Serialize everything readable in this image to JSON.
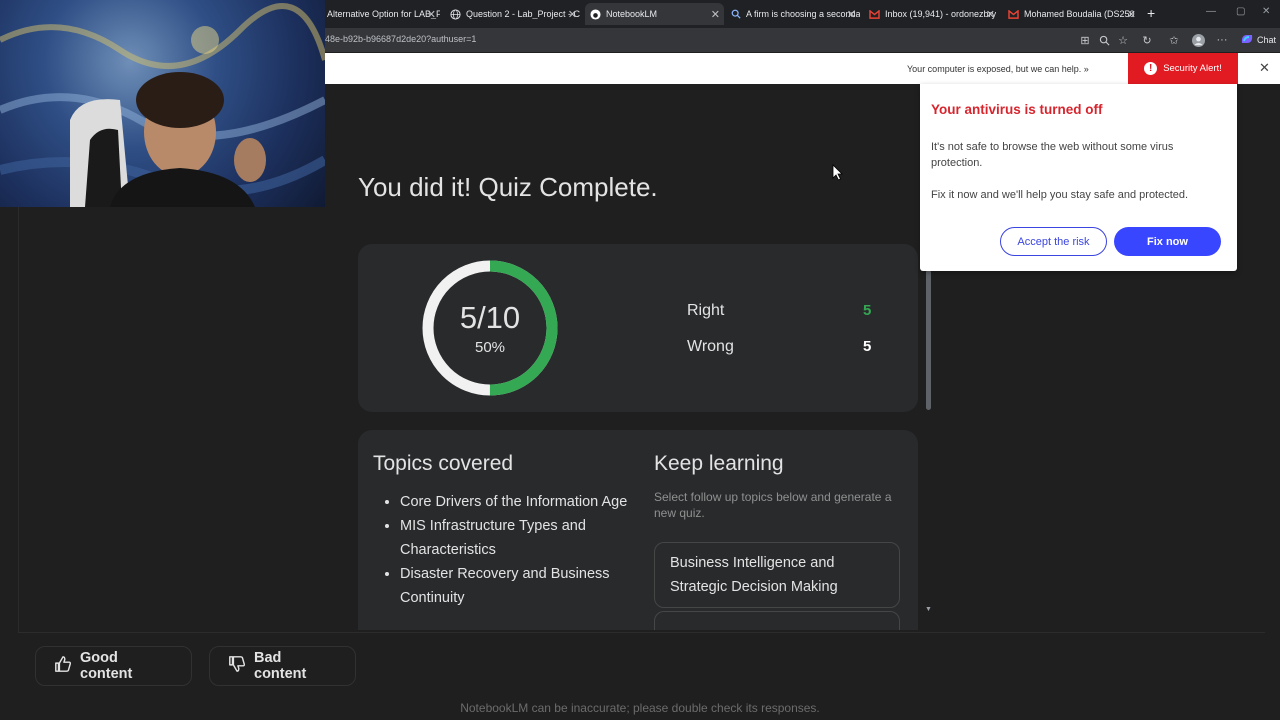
{
  "browser": {
    "tabs": [
      {
        "label": "Alternative Option for LAB_P",
        "icon": "page-icon",
        "active": false
      },
      {
        "label": "Question 2 - Lab_Project - C",
        "icon": "globe-icon",
        "active": false
      },
      {
        "label": "NotebookLM",
        "icon": "notebooklm-icon",
        "active": true
      },
      {
        "label": "A firm is choosing a seconda",
        "icon": "search-icon",
        "active": false
      },
      {
        "label": "Inbox (19,941) - ordonezbry",
        "icon": "gmail-icon",
        "active": false
      },
      {
        "label": "Mohamed Boudalia (DS250",
        "icon": "gmail-icon",
        "active": false
      }
    ],
    "url": "48e-b92b-b96687d2de20?authuser=1",
    "chat_label": "Chat"
  },
  "banner": {
    "message": "Your computer is exposed, but we can help. »",
    "alert_label": "Security Alert!"
  },
  "popup": {
    "title": "Your antivirus is turned off",
    "body1": "It's not safe to browse the web without some virus protection.",
    "body2": "Fix it now and we'll help you stay safe and protected.",
    "accept_label": "Accept the risk",
    "fix_label": "Fix now"
  },
  "quiz": {
    "title": "You did it! Quiz Complete.",
    "score": "5/10",
    "percent": "50%",
    "progress_fraction": 0.5,
    "right_label": "Right",
    "right_value": "5",
    "wrong_label": "Wrong",
    "wrong_value": "5"
  },
  "topics": {
    "heading": "Topics covered",
    "items": [
      "Core Drivers of the Information Age",
      "MIS Infrastructure Types and Characteristics",
      "Disaster Recovery and Business Continuity"
    ]
  },
  "keep": {
    "heading": "Keep learning",
    "subtext": "Select follow up topics below and generate a new quiz.",
    "chips": [
      "Business Intelligence and Strategic Decision Making"
    ]
  },
  "footer": {
    "good_label": "Good content",
    "bad_label": "Bad content",
    "disclaimer": "NotebookLM can be inaccurate; please double check its responses."
  },
  "colors": {
    "accent_green": "#34a853",
    "alert_red": "#e21a22",
    "button_blue": "#3946ff"
  }
}
